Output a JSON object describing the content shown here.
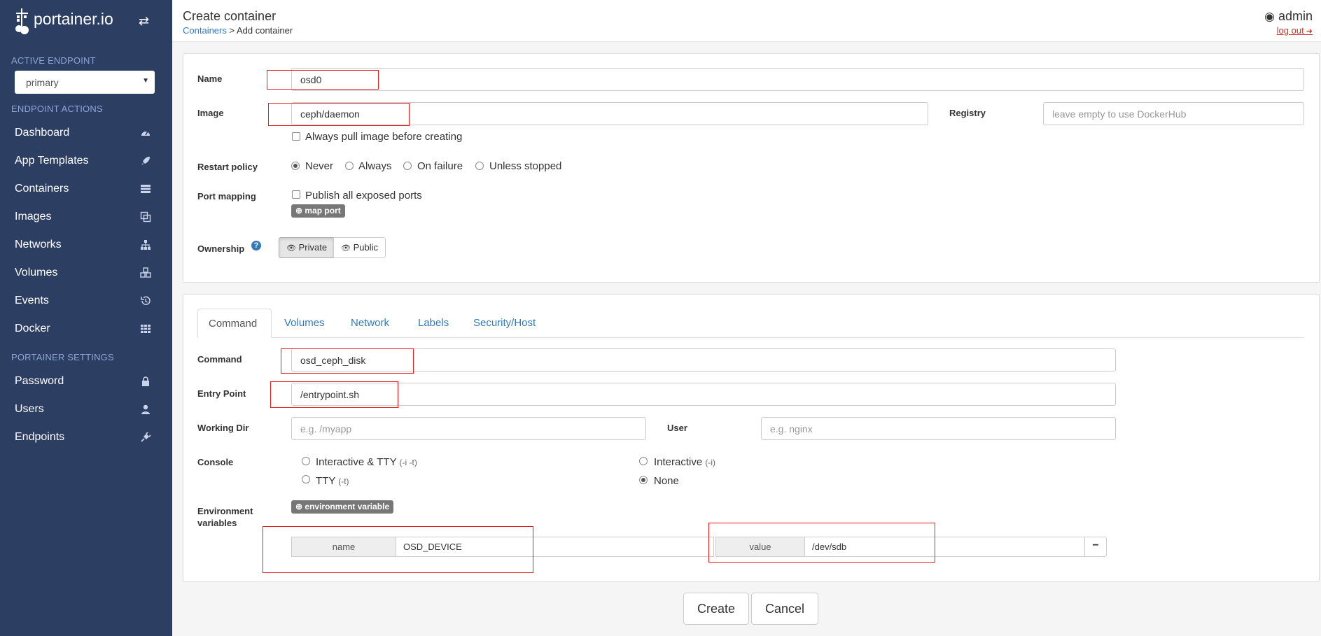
{
  "sidebar": {
    "brand": "portainer.io",
    "active_endpoint_title": "ACTIVE ENDPOINT",
    "endpoint_selected": "primary",
    "endpoint_actions_title": "ENDPOINT ACTIONS",
    "items": [
      {
        "label": "Dashboard",
        "icon": "tachometer-icon"
      },
      {
        "label": "App Templates",
        "icon": "rocket-icon"
      },
      {
        "label": "Containers",
        "icon": "server-icon"
      },
      {
        "label": "Images",
        "icon": "clone-icon"
      },
      {
        "label": "Networks",
        "icon": "sitemap-icon"
      },
      {
        "label": "Volumes",
        "icon": "cubes-icon"
      },
      {
        "label": "Events",
        "icon": "history-icon"
      },
      {
        "label": "Docker",
        "icon": "th-icon"
      }
    ],
    "settings_title": "PORTAINER SETTINGS",
    "settings_items": [
      {
        "label": "Password",
        "icon": "lock-icon"
      },
      {
        "label": "Users",
        "icon": "user-icon"
      },
      {
        "label": "Endpoints",
        "icon": "plug-icon"
      }
    ]
  },
  "header": {
    "title": "Create container",
    "breadcrumb_link": "Containers",
    "breadcrumb_rest": " > Add container",
    "user": "admin",
    "logout": "log out"
  },
  "form": {
    "name_label": "Name",
    "name_value": "osd0",
    "image_label": "Image",
    "image_value": "ceph/daemon",
    "registry_label": "Registry",
    "registry_placeholder": "leave empty to use DockerHub",
    "always_pull_label": "Always pull image before creating",
    "restart_label": "Restart policy",
    "restart_options": [
      "Never",
      "Always",
      "On failure",
      "Unless stopped"
    ],
    "restart_selected": "Never",
    "port_mapping_label": "Port mapping",
    "publish_all_label": "Publish all exposed ports",
    "map_port_button": "map port",
    "ownership_label": "Ownership",
    "ownership_private": "Private",
    "ownership_public": "Public"
  },
  "tabs": [
    "Command",
    "Volumes",
    "Network",
    "Labels",
    "Security/Host"
  ],
  "active_tab": "Command",
  "command": {
    "command_label": "Command",
    "command_value": "osd_ceph_disk",
    "entrypoint_label": "Entry Point",
    "entrypoint_value": "/entrypoint.sh",
    "workdir_label": "Working Dir",
    "workdir_placeholder": "e.g. /myapp",
    "user_label": "User",
    "user_placeholder": "e.g. nginx",
    "console_label": "Console",
    "console_options": [
      {
        "label": "Interactive & TTY",
        "hint": "(-i -t)"
      },
      {
        "label": "Interactive",
        "hint": "(-i)"
      },
      {
        "label": "TTY",
        "hint": "(-t)"
      },
      {
        "label": "None",
        "hint": ""
      }
    ],
    "console_selected": "None",
    "env_label_line1": "Environment",
    "env_label_line2": "variables",
    "env_button": "environment variable",
    "env_name_addon": "name",
    "env_name_value": "OSD_DEVICE",
    "env_value_addon": "value",
    "env_value_value": "/dev/sdb",
    "remove_symbol": "−"
  },
  "actions": {
    "create": "Create",
    "cancel": "Cancel"
  }
}
